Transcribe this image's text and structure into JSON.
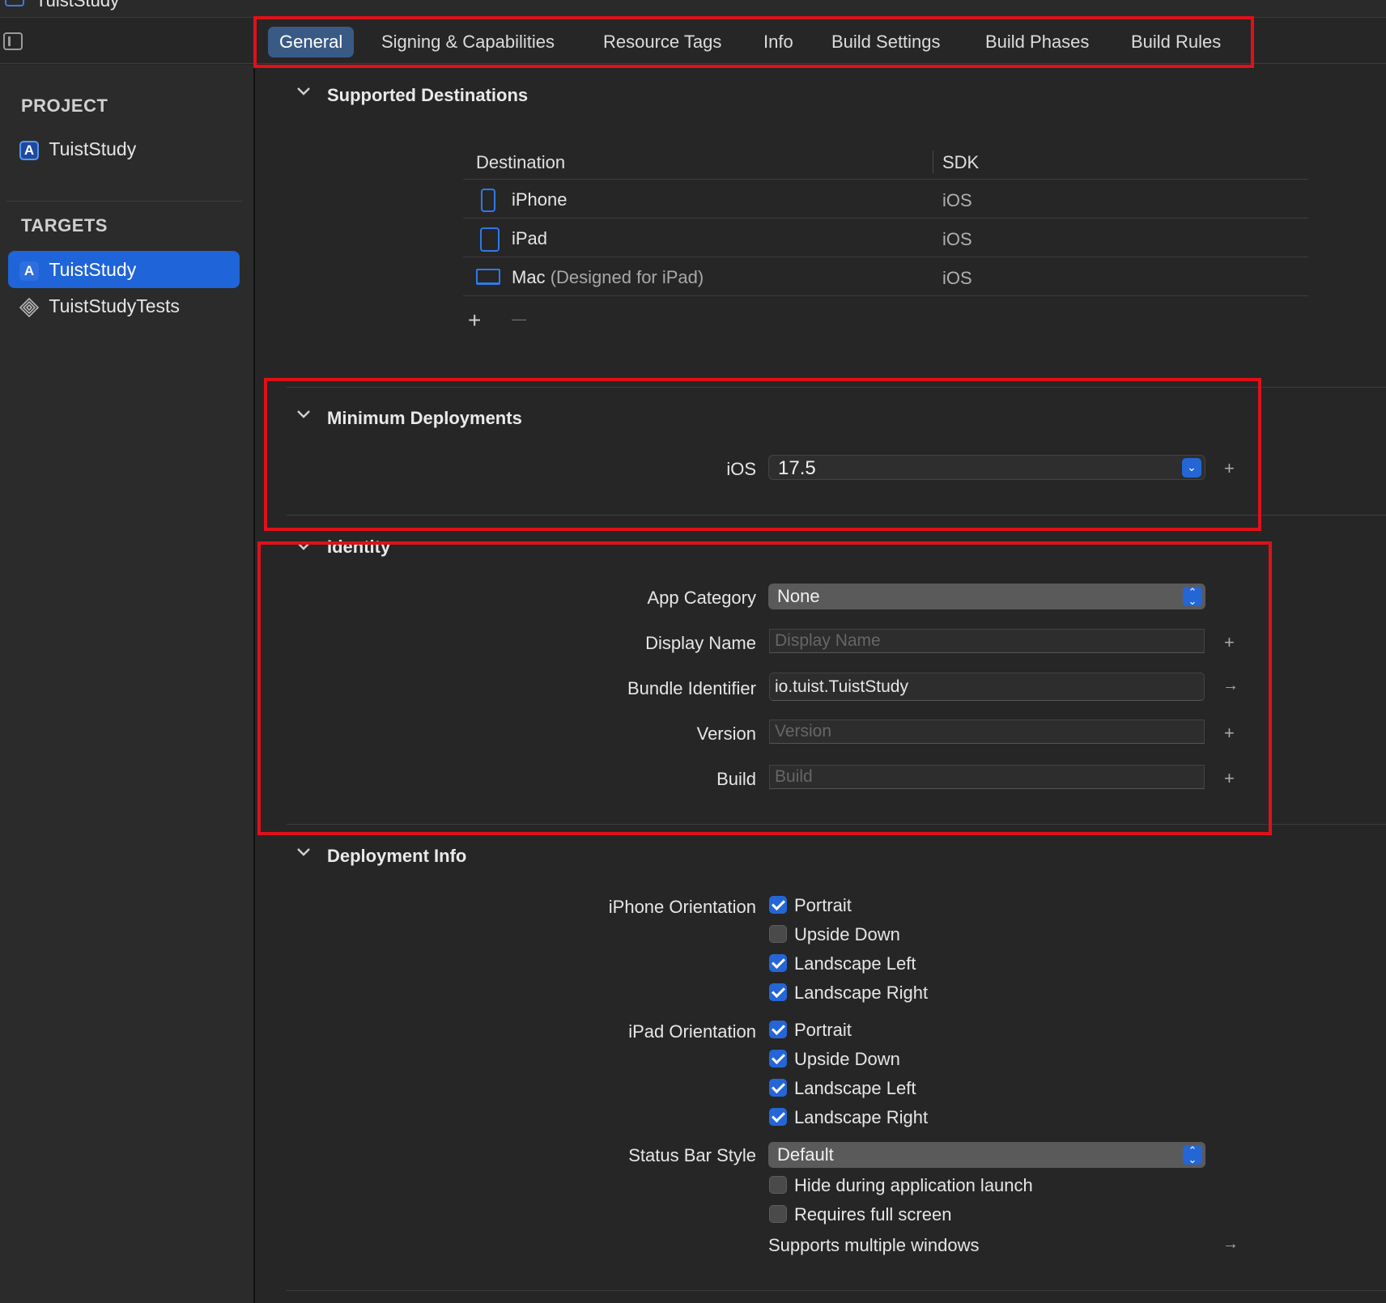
{
  "window": {
    "title": "TuistStudy"
  },
  "tabs": [
    {
      "label": "General",
      "active": true
    },
    {
      "label": "Signing & Capabilities"
    },
    {
      "label": "Resource Tags"
    },
    {
      "label": "Info"
    },
    {
      "label": "Build Settings"
    },
    {
      "label": "Build Phases"
    },
    {
      "label": "Build Rules"
    }
  ],
  "sidebar": {
    "project_header": "PROJECT",
    "project_item": "TuistStudy",
    "targets_header": "TARGETS",
    "targets": [
      {
        "label": "TuistStudy",
        "selected": true
      },
      {
        "label": "TuistStudyTests"
      }
    ]
  },
  "supported_destinations": {
    "title": "Supported Destinations",
    "columns": [
      "Destination",
      "SDK"
    ],
    "rows": [
      {
        "destination": "iPhone",
        "sdk": "iOS",
        "icon": "iphone-icon"
      },
      {
        "destination": "iPad",
        "sdk": "iOS",
        "icon": "ipad-icon"
      },
      {
        "destination": "Mac",
        "note": "(Designed for iPad)",
        "sdk": "iOS",
        "icon": "laptop-icon"
      }
    ],
    "add_symbol": "+",
    "remove_symbol": "—"
  },
  "minimum_deployments": {
    "title": "Minimum Deployments",
    "ios_label": "iOS",
    "ios_value": "17.5"
  },
  "identity": {
    "title": "Identity",
    "app_category_label": "App Category",
    "app_category_value": "None",
    "display_name_label": "Display Name",
    "display_name_placeholder": "Display Name",
    "bundle_identifier_label": "Bundle Identifier",
    "bundle_identifier_value": "io.tuist.TuistStudy",
    "version_label": "Version",
    "version_placeholder": "Version",
    "build_label": "Build",
    "build_placeholder": "Build"
  },
  "deployment_info": {
    "title": "Deployment Info",
    "iphone_orientation_label": "iPhone Orientation",
    "iphone_orientations": [
      {
        "label": "Portrait",
        "checked": true
      },
      {
        "label": "Upside Down",
        "checked": false
      },
      {
        "label": "Landscape Left",
        "checked": true
      },
      {
        "label": "Landscape Right",
        "checked": true
      }
    ],
    "ipad_orientation_label": "iPad Orientation",
    "ipad_orientations": [
      {
        "label": "Portrait",
        "checked": true
      },
      {
        "label": "Upside Down",
        "checked": true
      },
      {
        "label": "Landscape Left",
        "checked": true
      },
      {
        "label": "Landscape Right",
        "checked": true
      }
    ],
    "status_bar_style_label": "Status Bar Style",
    "status_bar_style_value": "Default",
    "hide_during_launch": {
      "label": "Hide during application launch",
      "checked": false
    },
    "requires_full_screen": {
      "label": "Requires full screen",
      "checked": false
    },
    "supports_multiple_windows": "Supports multiple windows"
  },
  "colors": {
    "accent": "#1f64d8",
    "annotation": "#e0101a",
    "background": "#262626"
  }
}
